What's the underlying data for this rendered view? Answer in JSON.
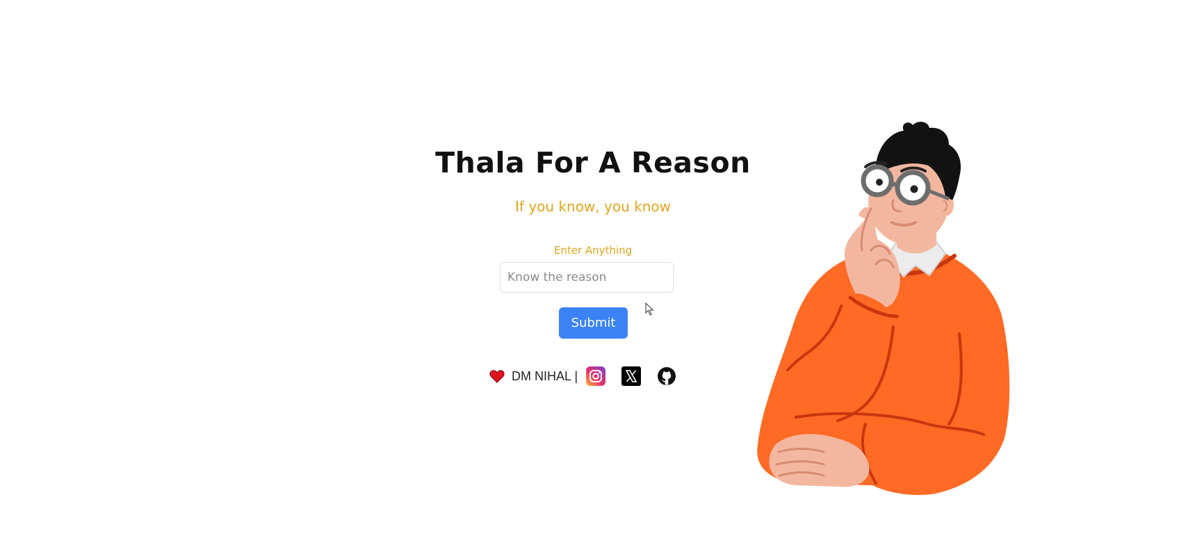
{
  "header": {
    "title": "Thala For A Reason",
    "subtitle": "If you know, you know"
  },
  "form": {
    "label": "Enter Anything",
    "input_placeholder": "Know the reason",
    "input_value": "",
    "submit_label": "Submit"
  },
  "footer": {
    "author": "DM NIHAL |",
    "links": [
      "instagram-icon",
      "x-icon",
      "github-icon"
    ]
  },
  "colors": {
    "accent": "#e0a51e",
    "button": "#3b82f6",
    "sweater": "#ff6a24",
    "skin": "#f3b7a0"
  }
}
